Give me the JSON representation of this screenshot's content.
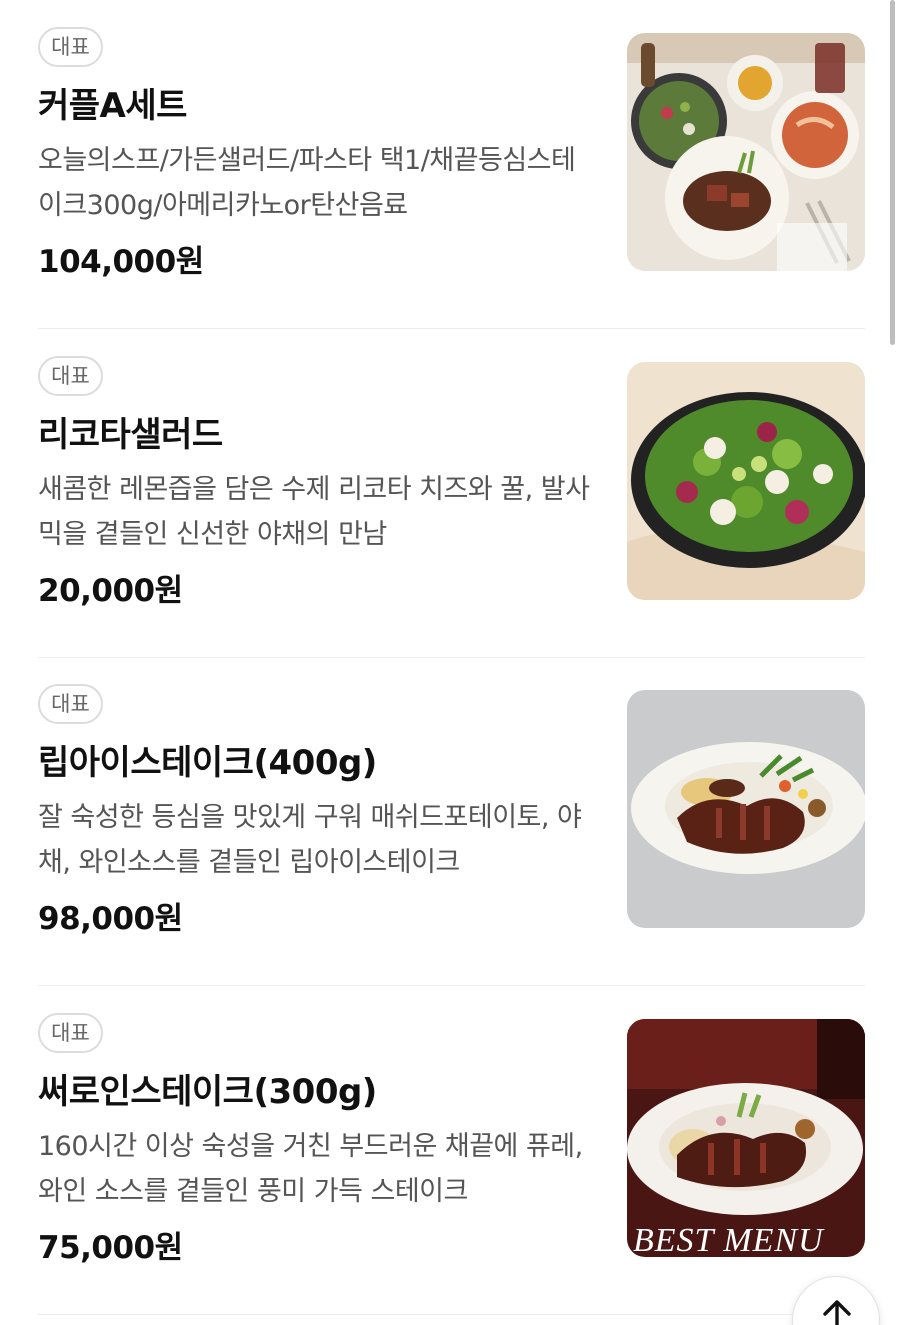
{
  "menu_items": [
    {
      "badge": "대표",
      "name": "커플A세트",
      "description": "오늘의스프/가든샐러드/파스타 택1/채끝등심스테이크300g/아메리카노or탄산음료",
      "price": "104,000원",
      "image_icon": "couple-set-food-photo"
    },
    {
      "badge": "대표",
      "name": "리코타샐러드",
      "description": "새콤한 레몬즙을 담은 수제 리코타 치즈와 꿀, 발사믹을 곁들인 신선한 야채의 만남",
      "price": "20,000원",
      "image_icon": "ricotta-salad-photo"
    },
    {
      "badge": "대표",
      "name": "립아이스테이크(400g)",
      "description": "잘 숙성한 등심을 맛있게 구워 매쉬드포테이토, 야채, 와인소스를 곁들인 립아이스테이크",
      "price": "98,000원",
      "image_icon": "ribeye-steak-photo"
    },
    {
      "badge": "대표",
      "name": "써로인스테이크(300g)",
      "description": "160시간 이상 숙성을 거친 부드러운 채끝에 퓨레, 와인 소스를 곁들인 풍미 가득 스테이크",
      "price": "75,000원",
      "image_icon": "sirloin-steak-photo",
      "image_caption": "BEST MENU"
    }
  ],
  "scroll_top_button": {
    "icon": "arrow-up-icon"
  },
  "colors": {
    "text_primary": "#111111",
    "text_secondary": "#555555",
    "badge_border": "#dcdcdc",
    "divider": "#ededed"
  }
}
